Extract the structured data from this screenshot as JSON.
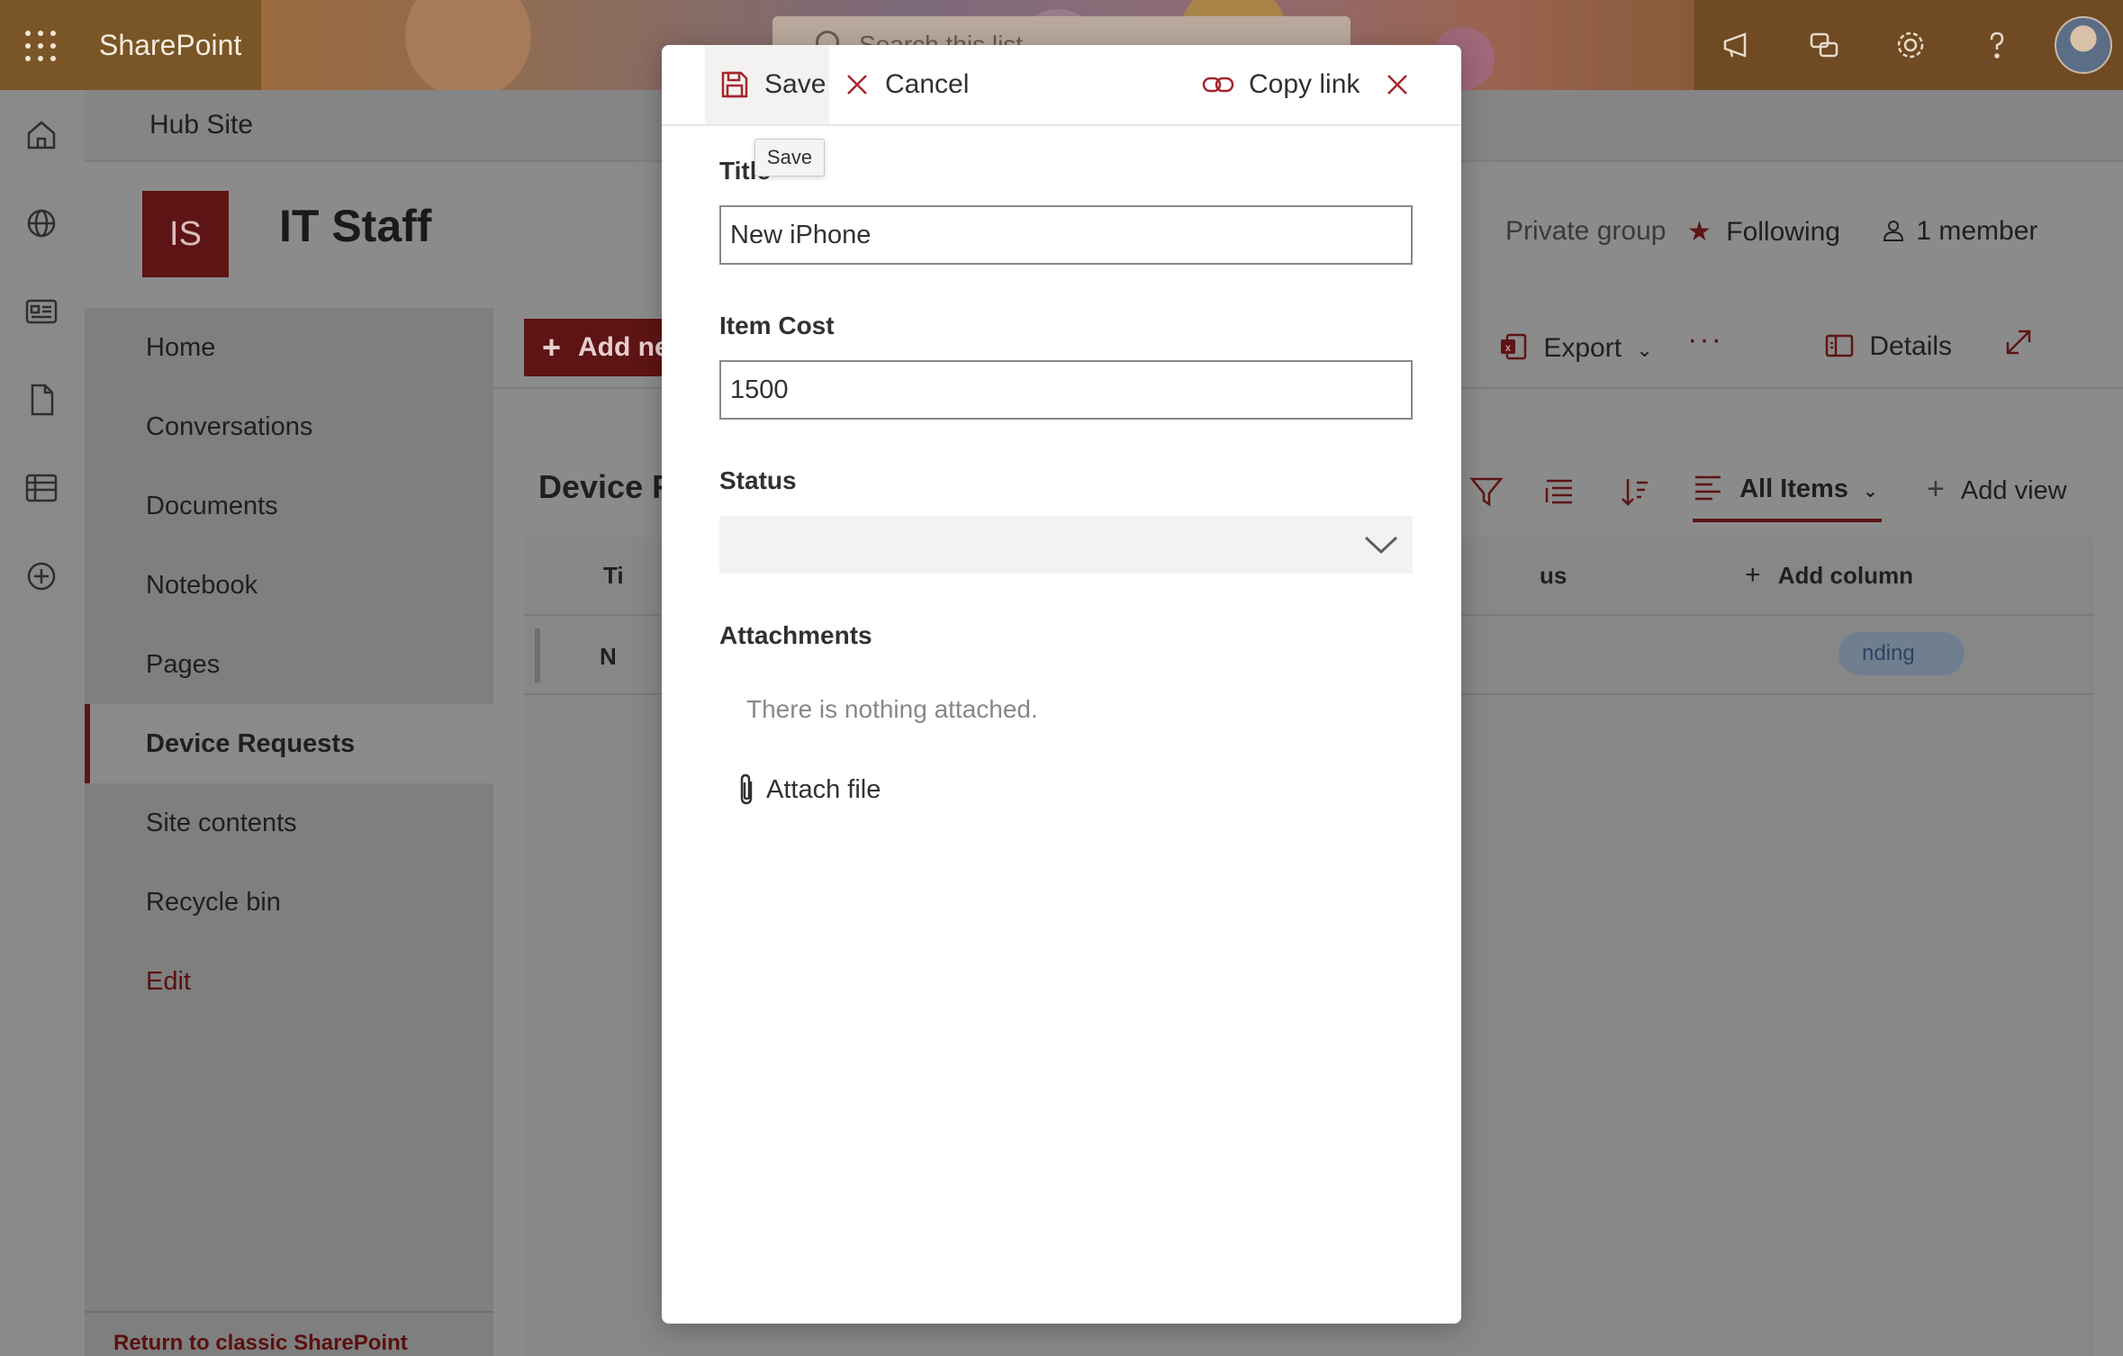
{
  "suite": {
    "brand": "SharePoint",
    "search_placeholder": "Search this list"
  },
  "hub": {
    "title": "Hub Site"
  },
  "site": {
    "logo_initials": "IS",
    "title": "IT Staff",
    "privacy": "Private group",
    "following_label": "Following",
    "members_label": "1 member"
  },
  "nav": {
    "items": [
      {
        "label": "Home"
      },
      {
        "label": "Conversations"
      },
      {
        "label": "Documents"
      },
      {
        "label": "Notebook"
      },
      {
        "label": "Pages"
      },
      {
        "label": "Device Requests",
        "selected": true
      },
      {
        "label": "Site contents"
      },
      {
        "label": "Recycle bin"
      },
      {
        "label": "Edit"
      }
    ],
    "return_link": "Return to classic SharePoint"
  },
  "commandbar": {
    "add_new": "Add ne",
    "export": "Export",
    "details": "Details"
  },
  "list": {
    "title": "Device R",
    "view_name": "All Items",
    "add_view": "Add view",
    "add_column": "Add column",
    "header_fragment_title": "Ti",
    "header_fragment_status": "us",
    "row_fragment_title": "N",
    "row_status_fragment": "nding"
  },
  "form": {
    "toolbar": {
      "save": "Save",
      "cancel": "Cancel",
      "copy_link": "Copy link"
    },
    "tooltip": "Save",
    "fields": {
      "title_label": "Title",
      "title_value": "New iPhone",
      "cost_label": "Item Cost",
      "cost_value": "1500",
      "status_label": "Status",
      "status_value": "",
      "attachments_label": "Attachments",
      "attachments_empty": "There is nothing attached.",
      "attach_file": "Attach file"
    }
  },
  "colors": {
    "brand_accent": "#a4262c",
    "suite_dark": "#6f4a22"
  }
}
